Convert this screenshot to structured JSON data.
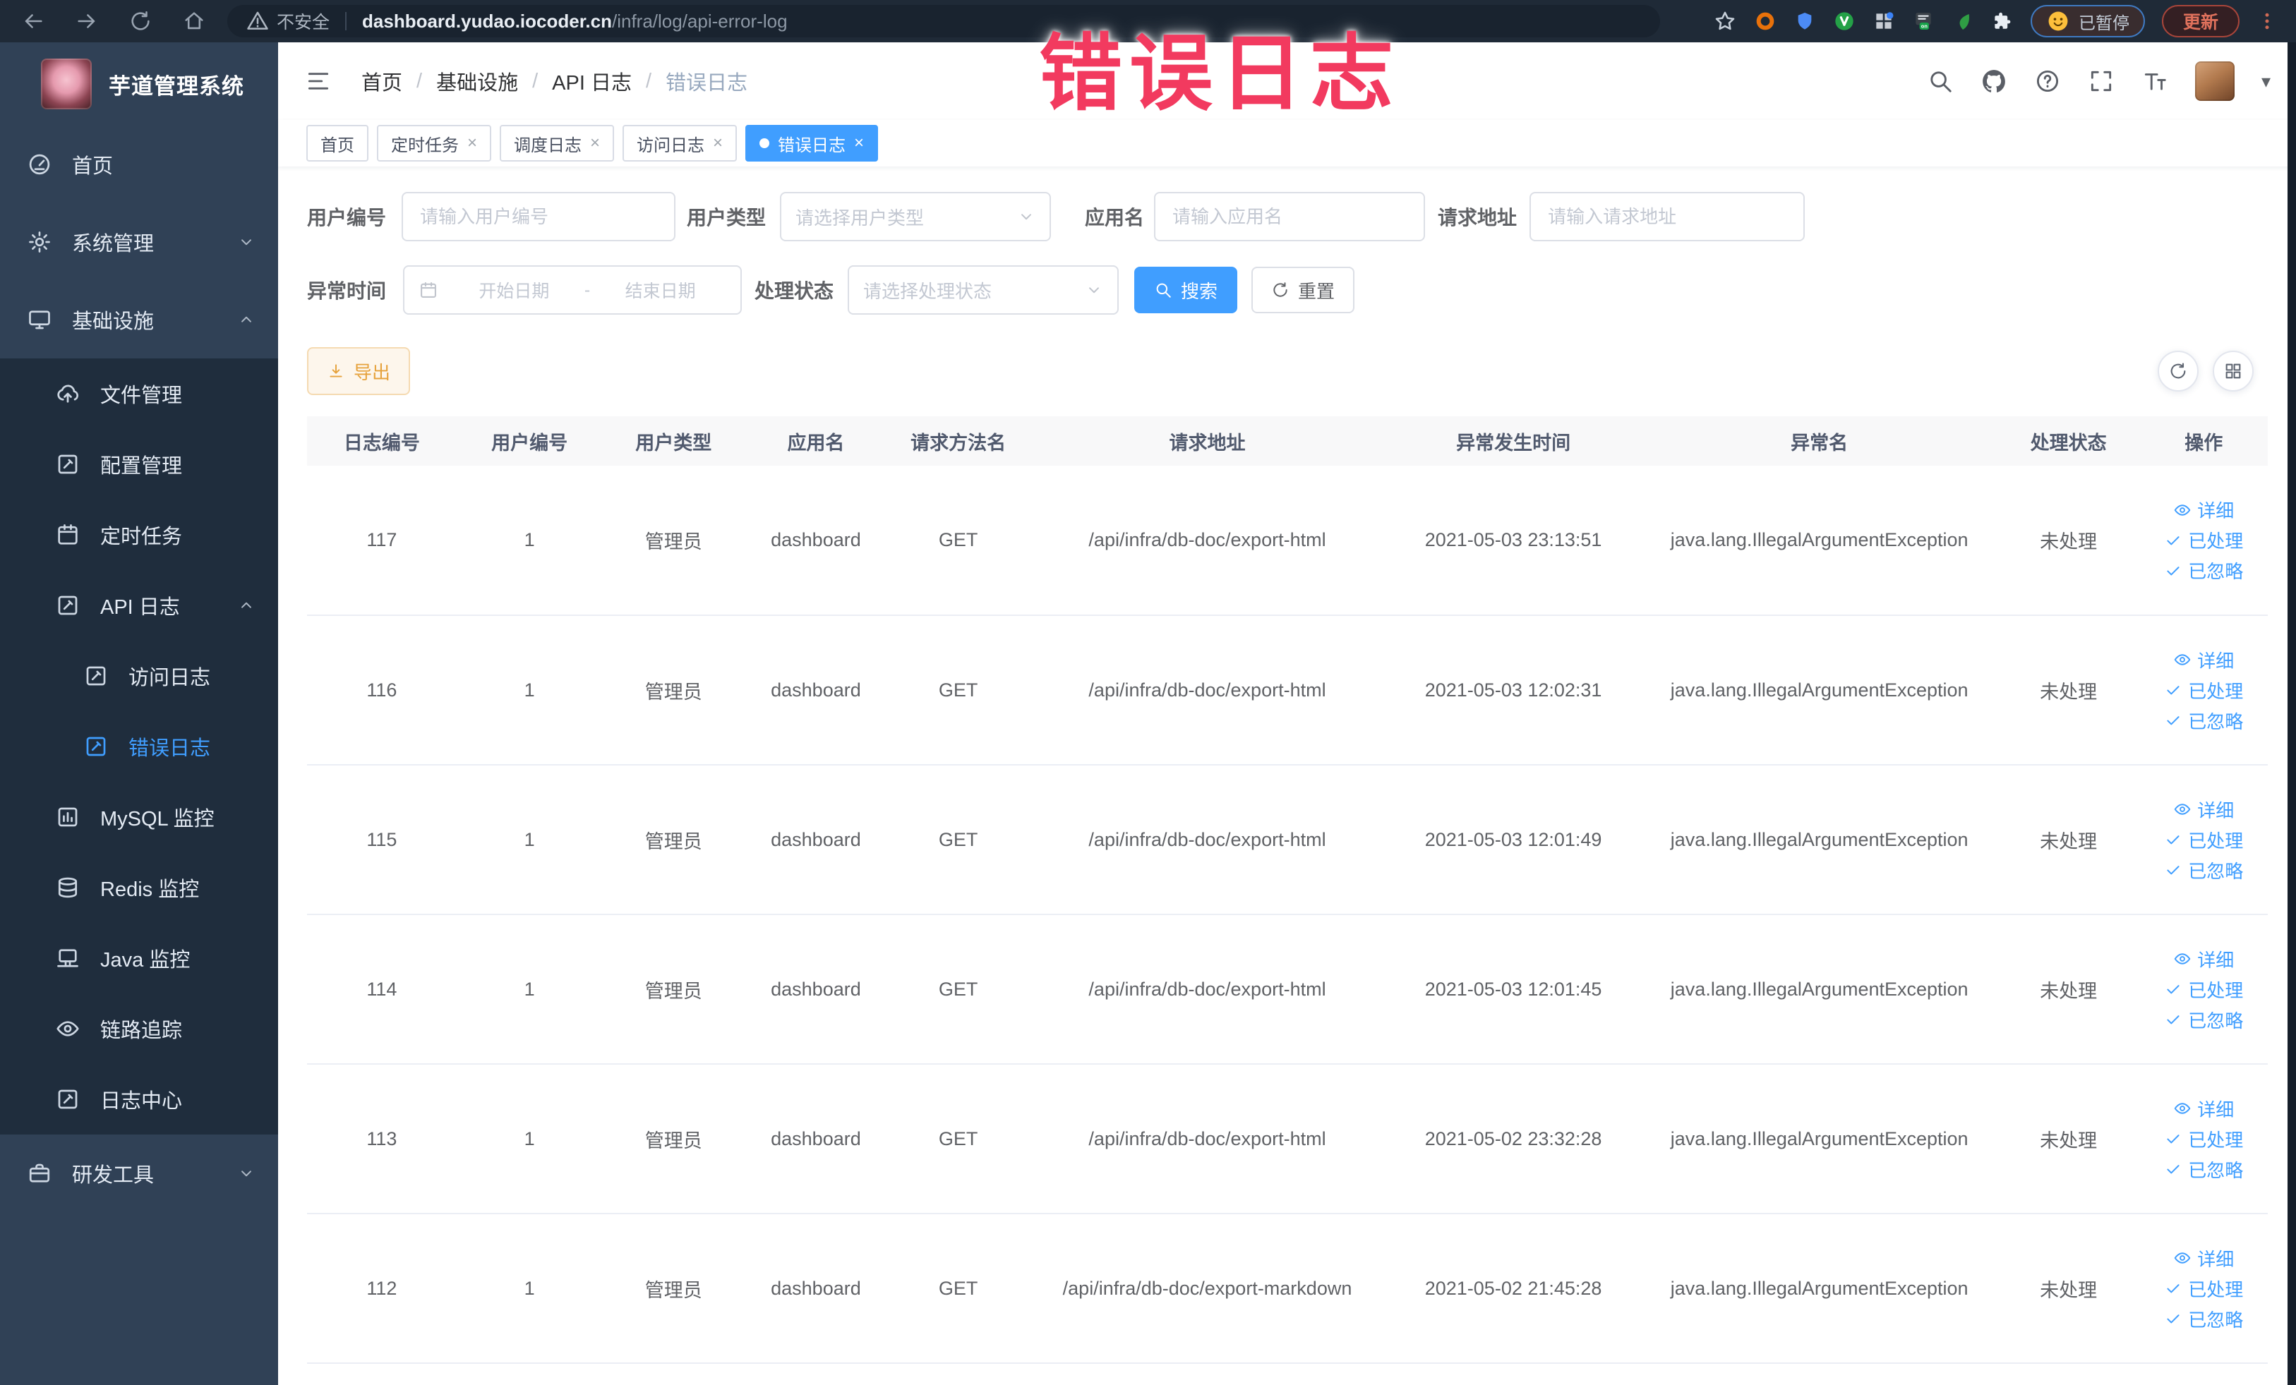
{
  "browser": {
    "security_label": "不安全",
    "url_host": "dashboard.yudao.iocoder.cn",
    "url_path": "/infra/log/api-error-log",
    "paused_label": "已暂停",
    "update_label": "更新"
  },
  "watermark": "错误日志",
  "sidebar": {
    "title": "芋道管理系统",
    "items": [
      {
        "label": "首页",
        "icon": "home",
        "level": "top"
      },
      {
        "label": "系统管理",
        "icon": "gear",
        "level": "top",
        "chevron": "down"
      },
      {
        "label": "基础设施",
        "icon": "monitor",
        "level": "top",
        "chevron": "up"
      },
      {
        "label": "文件管理",
        "icon": "upload",
        "level": "sub"
      },
      {
        "label": "配置管理",
        "icon": "edit",
        "level": "sub"
      },
      {
        "label": "定时任务",
        "icon": "timer",
        "level": "sub"
      },
      {
        "label": "API 日志",
        "icon": "doc-edit",
        "level": "sub",
        "chevron": "up"
      },
      {
        "label": "访问日志",
        "icon": "doc-edit",
        "level": "subsub"
      },
      {
        "label": "错误日志",
        "icon": "doc-edit",
        "level": "subsub",
        "active": true
      },
      {
        "label": "MySQL 监控",
        "icon": "chart",
        "level": "sub"
      },
      {
        "label": "Redis 监控",
        "icon": "database",
        "level": "sub"
      },
      {
        "label": "Java 监控",
        "icon": "java",
        "level": "sub"
      },
      {
        "label": "链路追踪",
        "icon": "eye",
        "level": "sub"
      },
      {
        "label": "日志中心",
        "icon": "doc-edit",
        "level": "sub"
      },
      {
        "label": "研发工具",
        "icon": "briefcase",
        "level": "top",
        "chevron": "down"
      }
    ]
  },
  "header": {
    "breadcrumb": [
      "首页",
      "基础设施",
      "API 日志",
      "错误日志"
    ]
  },
  "tabs": [
    {
      "label": "首页",
      "closable": false,
      "active": false
    },
    {
      "label": "定时任务",
      "closable": true,
      "active": false
    },
    {
      "label": "调度日志",
      "closable": true,
      "active": false
    },
    {
      "label": "访问日志",
      "closable": true,
      "active": false
    },
    {
      "label": "错误日志",
      "closable": true,
      "active": true
    }
  ],
  "filters": {
    "user_id_label": "用户编号",
    "user_id_placeholder": "请输入用户编号",
    "user_type_label": "用户类型",
    "user_type_placeholder": "请选择用户类型",
    "app_name_label": "应用名",
    "app_name_placeholder": "请输入应用名",
    "request_url_label": "请求地址",
    "request_url_placeholder": "请输入请求地址",
    "exception_time_label": "异常时间",
    "date_start_placeholder": "开始日期",
    "date_separator": "-",
    "date_end_placeholder": "结束日期",
    "process_status_label": "处理状态",
    "process_status_placeholder": "请选择处理状态",
    "search_label": "搜索",
    "reset_label": "重置"
  },
  "toolbar": {
    "export_label": "导出"
  },
  "table": {
    "columns": [
      "日志编号",
      "用户编号",
      "用户类型",
      "应用名",
      "请求方法名",
      "请求地址",
      "异常发生时间",
      "异常名",
      "处理状态",
      "操作"
    ],
    "row_actions": [
      "详细",
      "已处理",
      "已忽略"
    ],
    "rows": [
      {
        "id": "117",
        "user_id": "1",
        "user_type": "管理员",
        "app_name": "dashboard",
        "method": "GET",
        "url": "/api/infra/db-doc/export-html",
        "time": "2021-05-03 23:13:51",
        "exception": "java.lang.IllegalArgumentException",
        "status": "未处理"
      },
      {
        "id": "116",
        "user_id": "1",
        "user_type": "管理员",
        "app_name": "dashboard",
        "method": "GET",
        "url": "/api/infra/db-doc/export-html",
        "time": "2021-05-03 12:02:31",
        "exception": "java.lang.IllegalArgumentException",
        "status": "未处理"
      },
      {
        "id": "115",
        "user_id": "1",
        "user_type": "管理员",
        "app_name": "dashboard",
        "method": "GET",
        "url": "/api/infra/db-doc/export-html",
        "time": "2021-05-03 12:01:49",
        "exception": "java.lang.IllegalArgumentException",
        "status": "未处理"
      },
      {
        "id": "114",
        "user_id": "1",
        "user_type": "管理员",
        "app_name": "dashboard",
        "method": "GET",
        "url": "/api/infra/db-doc/export-html",
        "time": "2021-05-03 12:01:45",
        "exception": "java.lang.IllegalArgumentException",
        "status": "未处理"
      },
      {
        "id": "113",
        "user_id": "1",
        "user_type": "管理员",
        "app_name": "dashboard",
        "method": "GET",
        "url": "/api/infra/db-doc/export-html",
        "time": "2021-05-02 23:32:28",
        "exception": "java.lang.IllegalArgumentException",
        "status": "未处理"
      },
      {
        "id": "112",
        "user_id": "1",
        "user_type": "管理员",
        "app_name": "dashboard",
        "method": "GET",
        "url": "/api/infra/db-doc/export-markdown",
        "time": "2021-05-02 21:45:28",
        "exception": "java.lang.IllegalArgumentException",
        "status": "未处理"
      }
    ]
  },
  "colors": {
    "accent": "#409eff",
    "warning": "#e6a23c",
    "watermark_pink": "#f23a5f",
    "sidebar_bg": "#304156",
    "submenu_bg": "#1f2d3d"
  }
}
